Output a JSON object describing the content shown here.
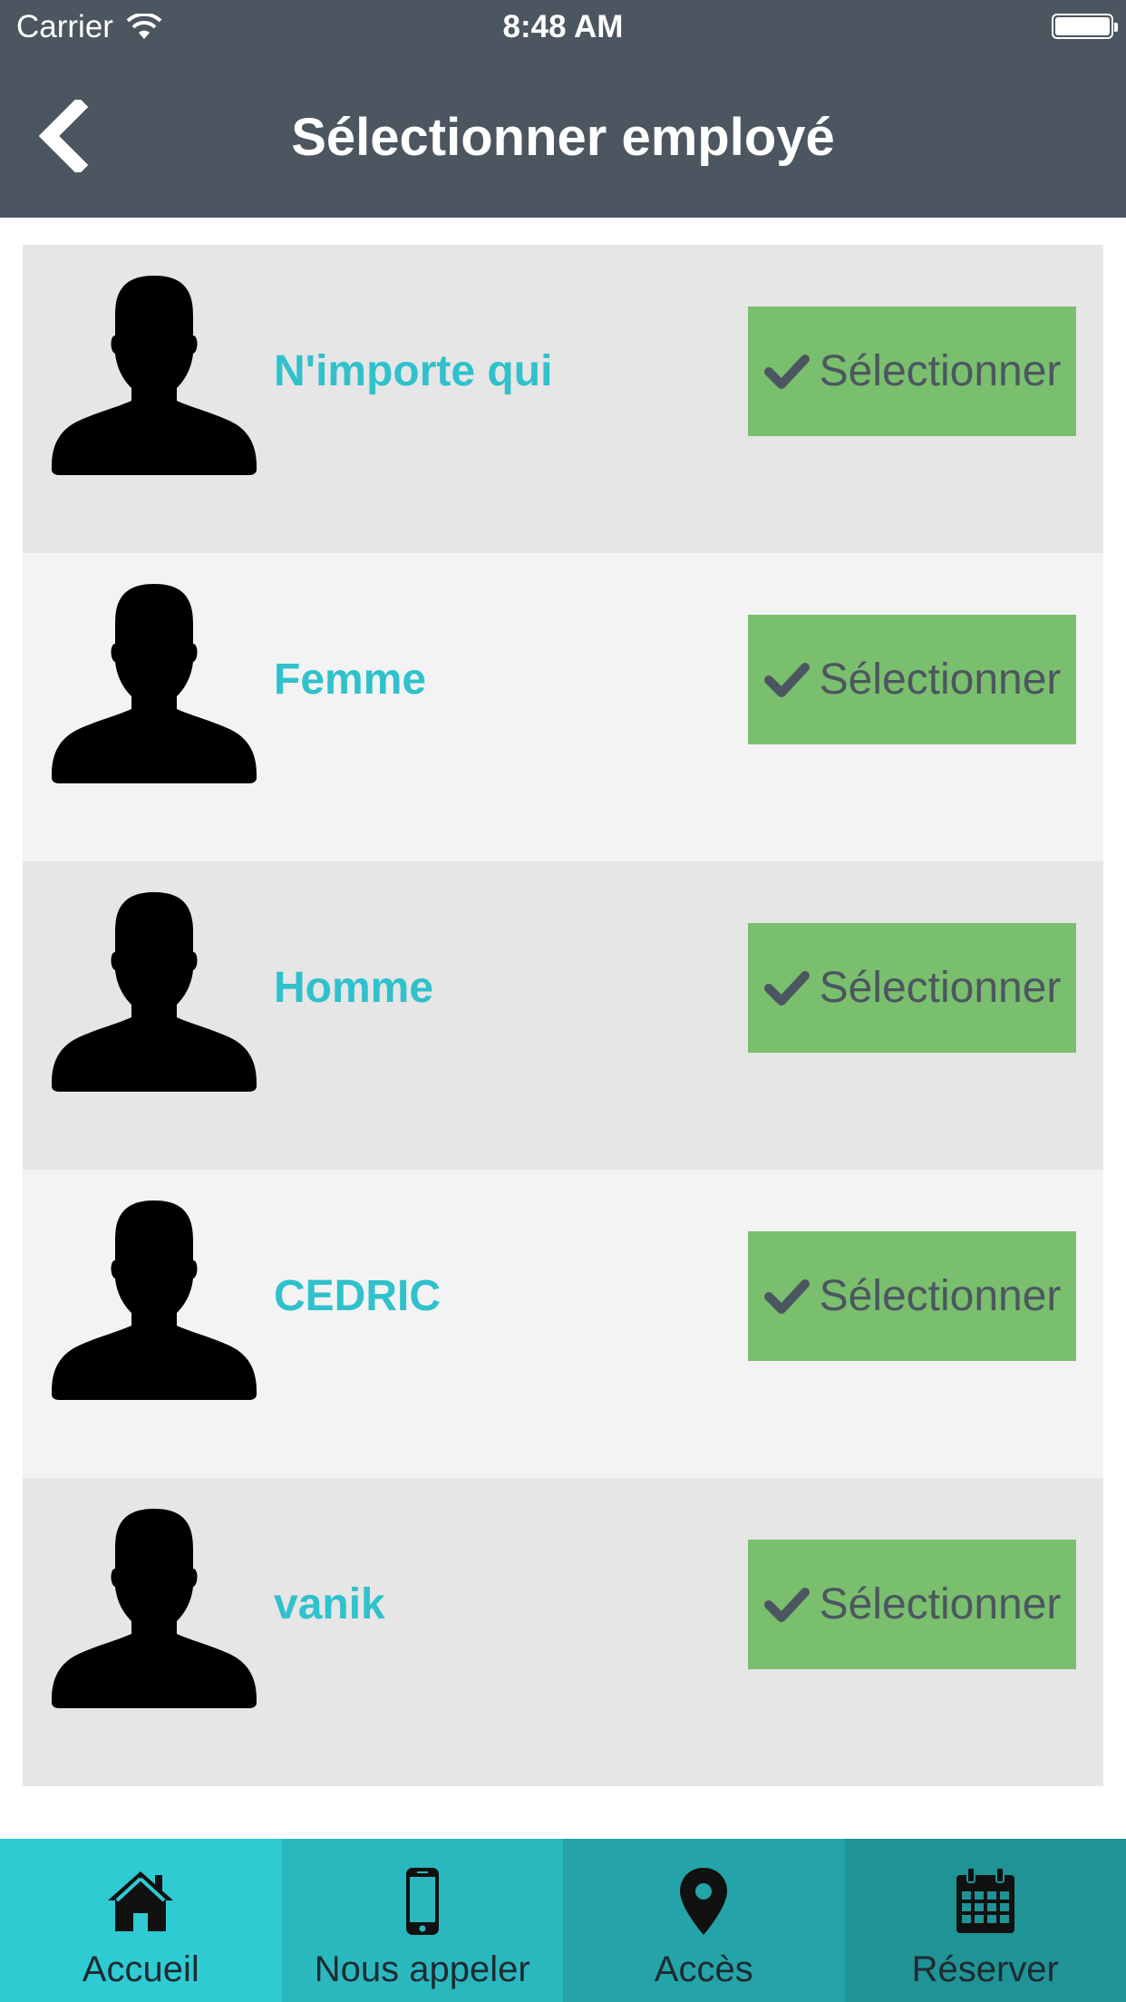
{
  "status_bar": {
    "carrier": "Carrier",
    "time": "8:48 AM"
  },
  "header": {
    "title": "Sélectionner employé"
  },
  "employees": [
    {
      "name": "N'importe qui",
      "button_label": "Sélectionner"
    },
    {
      "name": "Femme",
      "button_label": "Sélectionner"
    },
    {
      "name": "Homme",
      "button_label": "Sélectionner"
    },
    {
      "name": "CEDRIC",
      "button_label": "Sélectionner"
    },
    {
      "name": "vanik",
      "button_label": "Sélectionner"
    }
  ],
  "tabs": [
    {
      "label": "Accueil",
      "icon": "home-icon",
      "color": "#2ecbd3"
    },
    {
      "label": "Nous appeler",
      "icon": "phone-icon",
      "color": "#2ab8bf"
    },
    {
      "label": "Accès",
      "icon": "map-pin-icon",
      "color": "#24a4a8"
    },
    {
      "label": "Réserver",
      "icon": "calendar-icon",
      "color": "#1f9396"
    }
  ],
  "colors": {
    "header_bg": "#4c5660",
    "name_text": "#2fc1cc",
    "button_bg": "#7abf6d",
    "row_dark": "#e6e6e6",
    "row_light": "#f3f3f3"
  }
}
